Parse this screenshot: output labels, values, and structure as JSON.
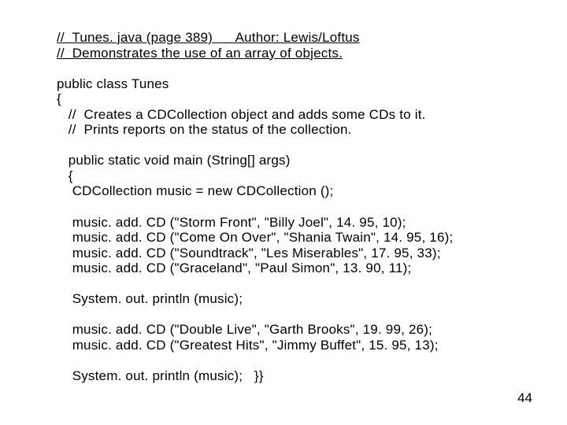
{
  "line01": "//  Tunes. java (page 389)      Author: Lewis/Loftus",
  "line02": "//  Demonstrates the use of an array of objects.",
  "line03": "public class Tunes",
  "line04": "{",
  "line05": "   //  Creates a CDCollection object and adds some CDs to it.",
  "line06": "   //  Prints reports on the status of the collection.",
  "line07": "   public static void main (String[] args)",
  "line08": "   {",
  "line09": "    CDCollection music = new CDCollection ();",
  "line10": "    music. add. CD (\"Storm Front\", \"Billy Joel\", 14. 95, 10);",
  "line11": "    music. add. CD (\"Come On Over\", \"Shania Twain\", 14. 95, 16);",
  "line12": "    music. add. CD (\"Soundtrack\", \"Les Miserables\", 17. 95, 33);",
  "line13": "    music. add. CD (\"Graceland\", \"Paul Simon\", 13. 90, 11);",
  "line14": "    System. out. println (music);",
  "line15": "    music. add. CD (\"Double Live\", \"Garth Brooks\", 19. 99, 26);",
  "line16": "    music. add. CD (\"Greatest Hits\", \"Jimmy Buffet\", 15. 95, 13);",
  "line17": "    System. out. println (music);   }}",
  "pageNumber": "44"
}
